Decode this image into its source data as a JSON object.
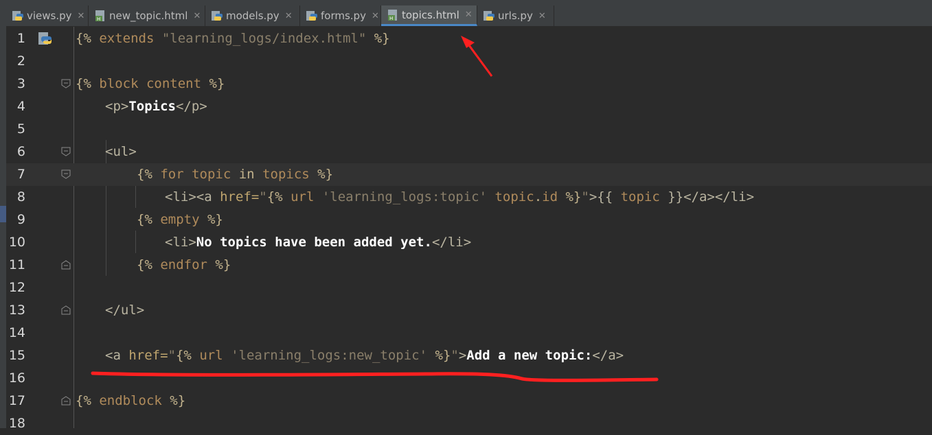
{
  "tabs": [
    {
      "label": "views.py",
      "type": "python"
    },
    {
      "label": "new_topic.html",
      "type": "html"
    },
    {
      "label": "models.py",
      "type": "python"
    },
    {
      "label": "forms.py",
      "type": "python"
    },
    {
      "label": "topics.html",
      "type": "html",
      "active": true
    },
    {
      "label": "urls.py",
      "type": "python"
    }
  ],
  "close_glyph": "✕",
  "line_numbers": [
    "1",
    "2",
    "3",
    "4",
    "5",
    "6",
    "7",
    "8",
    "9",
    "10",
    "11",
    "12",
    "13",
    "14",
    "15",
    "16",
    "17",
    "18"
  ],
  "code": {
    "l1": {
      "a": "{% ",
      "b": "extends ",
      "c": "\"learning_logs/index.html\"",
      "d": " %}"
    },
    "l3": {
      "a": "{% ",
      "b": "block content",
      "c": " %}"
    },
    "l4": {
      "a": "<p>",
      "b": "Topics",
      "c": "</p>"
    },
    "l6": {
      "a": "<ul>"
    },
    "l7": {
      "a": "{% ",
      "b": "for ",
      "c": "topic",
      "d": " in ",
      "e": "topics",
      "f": " %}"
    },
    "l8": {
      "a": "<li><a ",
      "b": "href=",
      "c": "\"",
      "d": "{% ",
      "e": "url ",
      "f": "'learning_logs:topic'",
      "g": " topic",
      "h": ".",
      "i": "id",
      "j": " %}",
      "k": "\"",
      "l": ">{{ ",
      "m": "topic",
      "n": " }}</a></li>"
    },
    "l9": {
      "a": "{% ",
      "b": "empty",
      "c": " %}"
    },
    "l10": {
      "a": "<li>",
      "b": "No topics have been added yet.",
      "c": "</li>"
    },
    "l11": {
      "a": "{% ",
      "b": "endfor",
      "c": " %}"
    },
    "l13": {
      "a": "</ul>"
    },
    "l15": {
      "a": "<a ",
      "b": "href=",
      "c": "\"",
      "d": "{% ",
      "e": "url ",
      "f": "'learning_logs:new_topic'",
      "g": " %}",
      "h": "\"",
      "i": ">",
      "j": "Add a new topic:",
      "k": "</a>"
    },
    "l17": {
      "a": "{% ",
      "b": "endblock",
      "c": " %}"
    }
  },
  "icons": {
    "python": "python-file-icon",
    "html": "html-file-icon",
    "fold": "fold-marker-icon",
    "annotation_arrow": "red-arrow",
    "annotation_underline": "red-underline"
  },
  "colors": {
    "accent_tab_underline": "#4a88c7",
    "annotation": "#ff2020",
    "background": "#2b2b2b"
  }
}
